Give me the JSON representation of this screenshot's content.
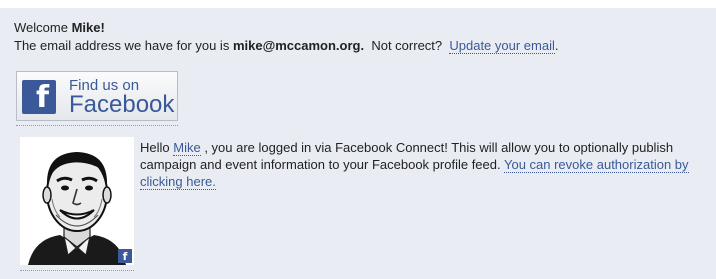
{
  "welcome": {
    "prefix": "Welcome ",
    "name": "Mike!"
  },
  "email_line": {
    "prefix": "The email address we have for you is ",
    "email": "mike@mccamon.org.",
    "middle": "  Not correct?  ",
    "update_link": "Update your email",
    "suffix": "."
  },
  "facebook_button": {
    "icon": "facebook-f-icon",
    "icon_glyph": "f",
    "small_text": "Find us on",
    "big_text": "Facebook",
    "brand_color": "#3b5998"
  },
  "avatar": {
    "badge_icon": "facebook-f-icon",
    "badge_glyph": "f"
  },
  "connect": {
    "hello": "Hello ",
    "user_link": "Mike",
    "message": " , you are logged in via Facebook Connect! This will allow you to optionally publish campaign and event information to your Facebook profile feed. ",
    "revoke_link": "You can revoke authorization by clicking here."
  }
}
